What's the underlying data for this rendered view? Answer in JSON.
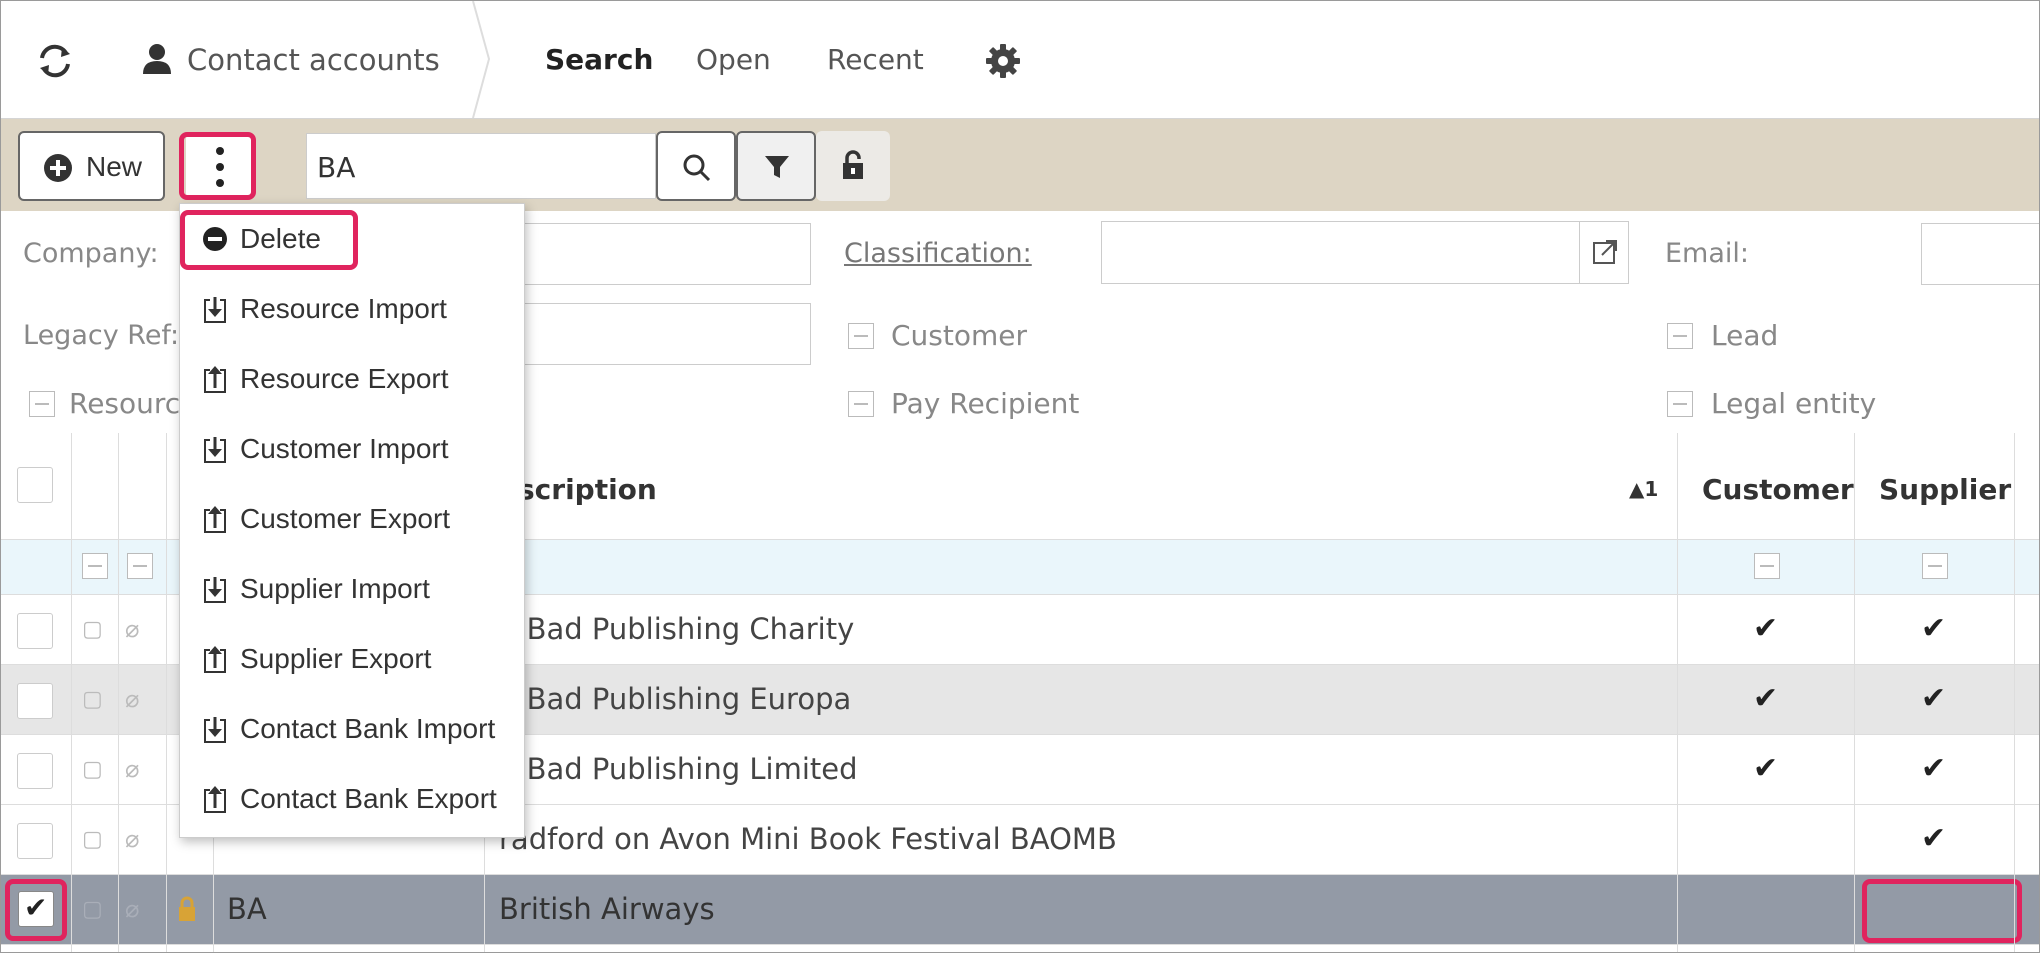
{
  "header": {
    "refresh_icon": "refresh-icon",
    "module_icon": "person-icon",
    "module_title": "Contact accounts",
    "tabs": [
      "Search",
      "Open",
      "Recent"
    ],
    "settings_icon": "gear-icon"
  },
  "toolbar": {
    "new_label": "New",
    "search_value": "BA"
  },
  "filters": {
    "company_label": "Company:",
    "legacy_label": "Legacy Ref:",
    "resource_label": "Resourc",
    "classification_label": "Classification:",
    "email_label": "Email:",
    "customer_label": "Customer",
    "pay_recipient_label": "Pay Recipient",
    "lead_label": "Lead",
    "legal_entity_label": "Legal entity"
  },
  "menu": {
    "items": [
      "Delete",
      "Resource Import",
      "Resource Export",
      "Customer Import",
      "Customer Export",
      "Supplier Import",
      "Supplier Export",
      "Contact Bank Import",
      "Contact Bank Export"
    ]
  },
  "grid": {
    "headers": {
      "description": "escription",
      "sort_indicator": "▲1",
      "customer": "Customer",
      "supplier": "Supplier"
    },
    "rows": [
      {
        "code": "",
        "description": "g Bad Publishing Charity"
      },
      {
        "code": "",
        "description": "g Bad Publishing Europa"
      },
      {
        "code": "",
        "description": "g Bad Publishing Limited"
      },
      {
        "code": "",
        "description": "radford on Avon Mini Book Festival BAOMB"
      },
      {
        "code": "BA",
        "description": "British Airways"
      }
    ],
    "check_mark": "✔"
  },
  "colors": {
    "highlight": "#e0245e",
    "toolbar_bg": "#ddd5c4",
    "selected_row": "#939aa6",
    "alt_row": "#e6e6e6"
  }
}
